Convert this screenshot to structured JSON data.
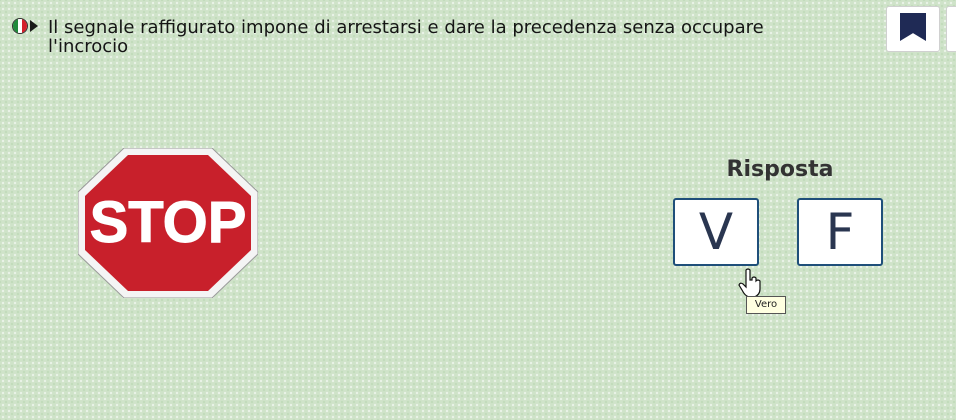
{
  "question": {
    "text": "Il segnale raffigurato impone di arrestarsi e dare la precedenza senza occupare l'incrocio"
  },
  "icons": {
    "language": "italian-flag-icon",
    "audio": "speaker-play-icon",
    "bookmark": "bookmark-icon",
    "cursor": "hand-pointer-icon"
  },
  "sign": {
    "text": "STOP",
    "color": "#c8202b"
  },
  "answer": {
    "label": "Risposta",
    "true_label": "V",
    "false_label": "F",
    "tooltip": "Vero"
  }
}
